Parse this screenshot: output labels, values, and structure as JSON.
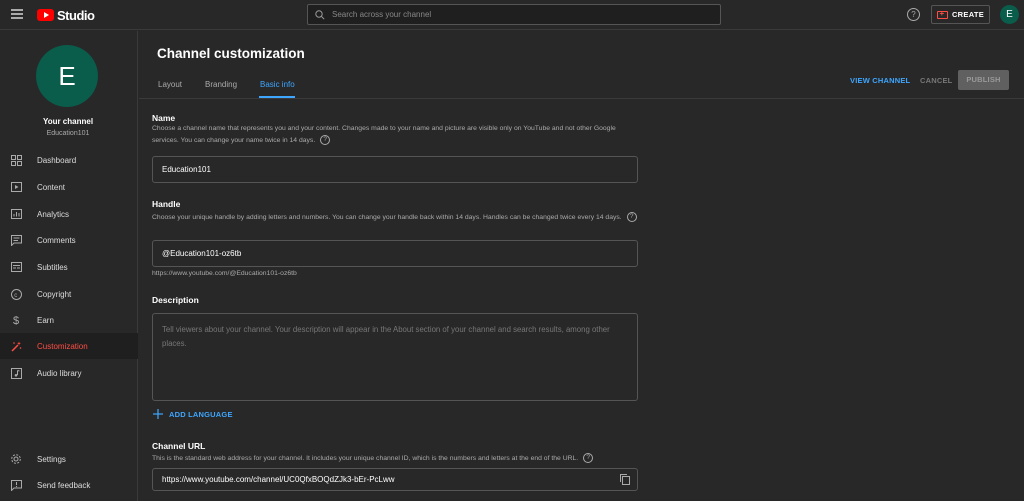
{
  "app": {
    "logo_text": "Studio"
  },
  "header": {
    "search_placeholder": "Search across your channel",
    "help_label": "?",
    "create_label": "CREATE",
    "avatar_letter": "E"
  },
  "sidebar": {
    "avatar_letter": "E",
    "your_channel_label": "Your channel",
    "channel_name": "Education101",
    "items": [
      {
        "label": "Dashboard",
        "icon": "dashboard-icon"
      },
      {
        "label": "Content",
        "icon": "content-icon"
      },
      {
        "label": "Analytics",
        "icon": "analytics-icon"
      },
      {
        "label": "Comments",
        "icon": "comments-icon"
      },
      {
        "label": "Subtitles",
        "icon": "subtitles-icon"
      },
      {
        "label": "Copyright",
        "icon": "copyright-icon"
      },
      {
        "label": "Earn",
        "icon": "earn-icon"
      },
      {
        "label": "Customization",
        "icon": "customization-icon",
        "active": true
      },
      {
        "label": "Audio library",
        "icon": "audio-library-icon"
      }
    ],
    "bottom_items": [
      {
        "label": "Settings",
        "icon": "gear-icon"
      },
      {
        "label": "Send feedback",
        "icon": "feedback-icon"
      }
    ]
  },
  "main": {
    "title": "Channel customization",
    "tabs": [
      {
        "label": "Layout"
      },
      {
        "label": "Branding"
      },
      {
        "label": "Basic info",
        "active": true
      }
    ],
    "actions": {
      "view_channel": "VIEW CHANNEL",
      "cancel": "CANCEL",
      "publish": "PUBLISH"
    },
    "name": {
      "title": "Name",
      "description": "Choose a channel name that represents you and your content. Changes made to your name and picture are visible only on YouTube and not other Google services. You can change your name twice in 14 days.",
      "value": "Education101"
    },
    "handle": {
      "title": "Handle",
      "description": "Choose your unique handle by adding letters and numbers. You can change your handle back within 14 days. Handles can be changed twice every 14 days.",
      "value": "@Education101-oz6tb",
      "url": "https://www.youtube.com/@Education101-oz6tb"
    },
    "description": {
      "title": "Description",
      "placeholder": "Tell viewers about your channel. Your description will appear in the About section of your channel and search results, among other places.",
      "add_language": "ADD LANGUAGE"
    },
    "channel_url": {
      "title": "Channel URL",
      "description": "This is the standard web address for your channel. It includes your unique channel ID, which is the numbers and letters at the end of the URL.",
      "value": "https://www.youtube.com/channel/UC0QfxBOQdZJk3-bEr-PcLww"
    }
  },
  "colors": {
    "background": "#282828",
    "accent_blue": "#3ea6ff",
    "accent_red": "#ff4e45",
    "avatar_green": "#0a5c4b"
  }
}
